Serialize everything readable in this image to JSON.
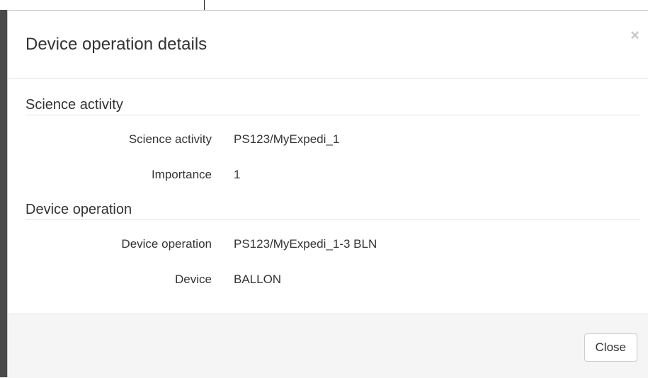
{
  "modal": {
    "title": "Device operation details",
    "close_icon": "close-icon",
    "close_glyph": "×",
    "footer": {
      "close_label": "Close"
    }
  },
  "sections": [
    {
      "legend": "Science activity",
      "fields": [
        {
          "label": "Science activity",
          "value": "PS123/MyExpedi_1"
        },
        {
          "label": "Importance",
          "value": "1"
        }
      ]
    },
    {
      "legend": "Device operation",
      "fields": [
        {
          "label": "Device operation",
          "value": "PS123/MyExpedi_1-3 BLN"
        },
        {
          "label": "Device",
          "value": "BALLON"
        }
      ]
    }
  ]
}
